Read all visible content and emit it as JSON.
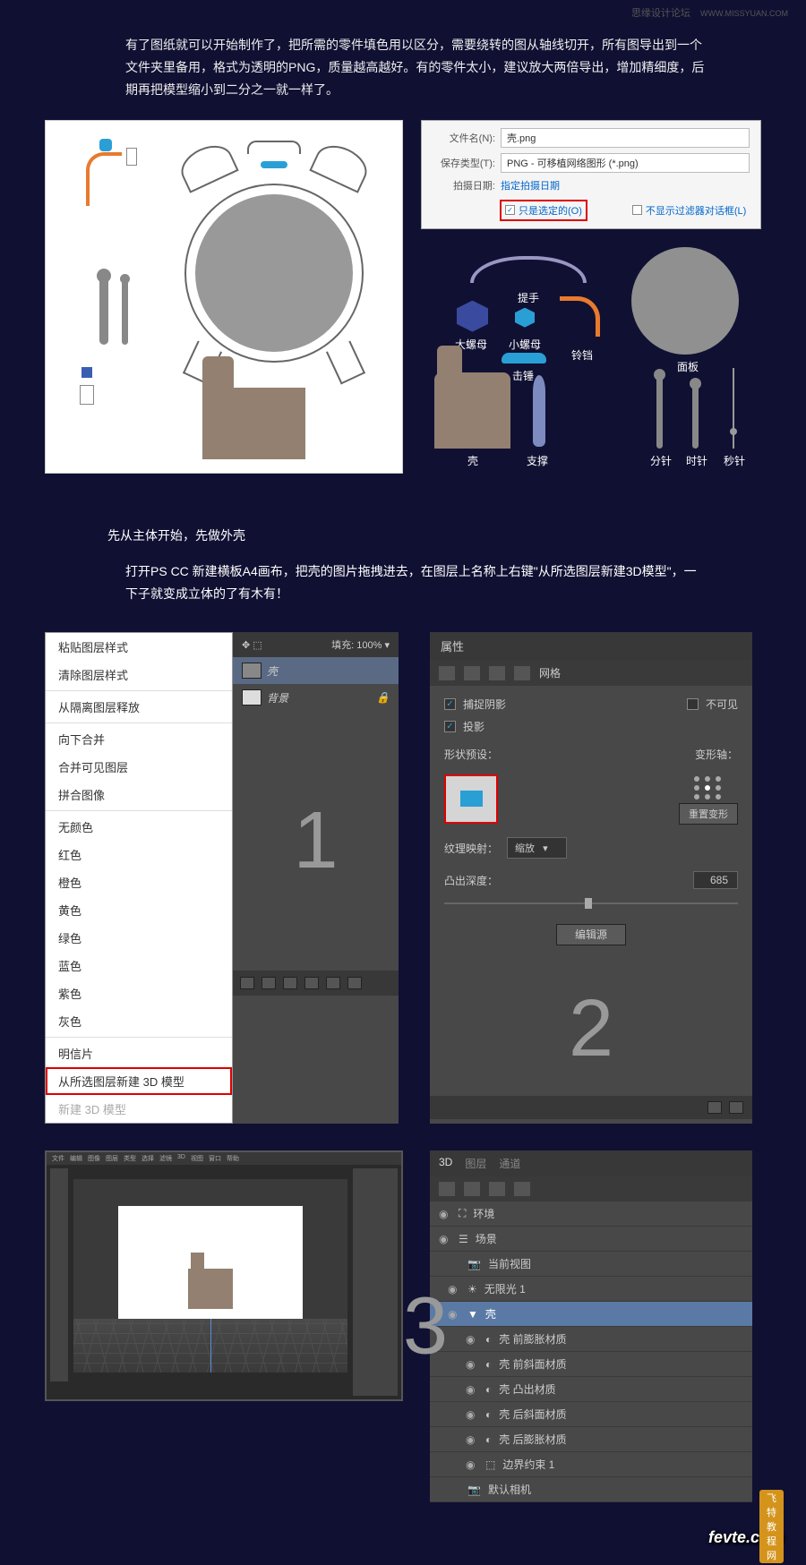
{
  "header": {
    "site": "思缘设计论坛",
    "url": "WWW.MISSYUAN.COM"
  },
  "intro": "有了图纸就可以开始制作了，把所需的零件填色用以区分，需要绕转的图从轴线切开，所有图导出到一个文件夹里备用，格式为透明的PNG，质量越高越好。有的零件太小，建议放大两倍导出，增加精细度，后期再把模型缩小到二分之一就一样了。",
  "save_dialog": {
    "filename_label": "文件名(N):",
    "filename_value": "壳.png",
    "type_label": "保存类型(T):",
    "type_value": "PNG - 可移植网络图形 (*.png)",
    "date_label": "拍摄日期:",
    "date_value": "指定拍摄日期",
    "check_selected": "只是选定的(O)",
    "check_nofilter": "不显示过滤器对话框(L)"
  },
  "parts": {
    "handle": "提手",
    "big_nut": "大螺母",
    "small_nut": "小螺母",
    "bell": "铃铛",
    "panel": "面板",
    "hammer": "击锤",
    "shell": "壳",
    "support": "支撑",
    "minute": "分针",
    "hour": "时针",
    "second": "秒针"
  },
  "section2": {
    "title": "先从主体开始，先做外壳",
    "body": "打开PS CC 新建横板A4画布，把壳的图片拖拽进去，在图层上名称上右键\"从所选图层新建3D模型\"，一下子就变成立体的了有木有！"
  },
  "context_menu": {
    "paste_style": "粘贴图层样式",
    "clear_style": "清除图层样式",
    "release_iso": "从隔离图层释放",
    "merge_down": "向下合并",
    "merge_visible": "合并可见图层",
    "flatten": "拼合图像",
    "no_color": "无颜色",
    "red": "红色",
    "orange": "橙色",
    "yellow": "黄色",
    "green": "绿色",
    "blue": "蓝色",
    "violet": "紫色",
    "gray": "灰色",
    "postcard": "明信片",
    "new_3d": "从所选图层新建 3D 模型",
    "new_3d_gray": "新建 3D 模型"
  },
  "layers": {
    "fill_label": "填充:",
    "fill_value": "100%",
    "layer1": "壳",
    "layer2": "背景"
  },
  "numbers": {
    "one": "1",
    "two": "2",
    "three": "3"
  },
  "props": {
    "title": "属性",
    "mesh": "网格",
    "catch_shadow": "捕捉阴影",
    "invisible": "不可见",
    "cast_shadow": "投影",
    "shape_preset": "形状预设：",
    "deform_axis": "变形轴：",
    "reset_deform": "重置变形",
    "texture_map": "纹理映射：",
    "texture_val": "缩放",
    "extrude_depth": "凸出深度：",
    "depth_value": "685",
    "edit_source": "编辑源"
  },
  "ps_menu": [
    "文件",
    "编辑",
    "图像",
    "图层",
    "类型",
    "选择",
    "滤镜",
    "3D",
    "视图",
    "窗口",
    "帮助"
  ],
  "scene": {
    "tab_3d": "3D",
    "tab_layers": "图层",
    "tab_channels": "通道",
    "env": "环境",
    "scene": "场景",
    "current_view": "当前视图",
    "infinite_light": "无限光 1",
    "shell": "壳",
    "mat1": "壳 前膨胀材质",
    "mat2": "壳 前斜面材质",
    "mat3": "壳 凸出材质",
    "mat4": "壳 后斜面材质",
    "mat5": "壳 后膨胀材质",
    "boundary": "边界约束 1",
    "default_cam": "默认相机"
  },
  "watermark": {
    "main": "fevte.com",
    "sub": "飞特教程网"
  }
}
